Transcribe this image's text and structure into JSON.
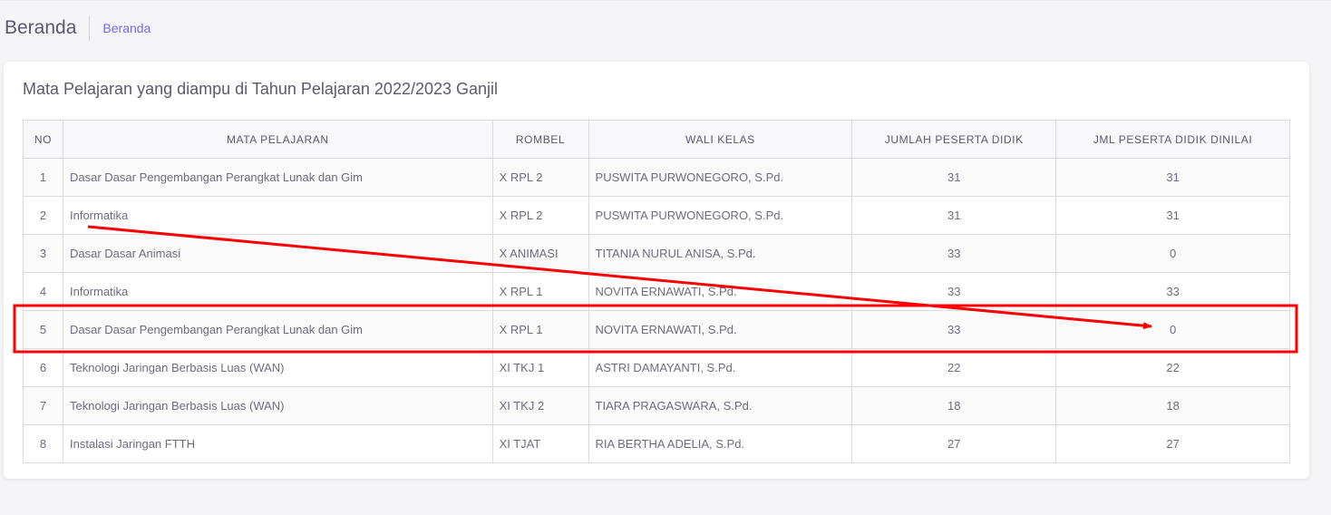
{
  "header": {
    "title": "Beranda",
    "breadcrumb": "Beranda"
  },
  "card": {
    "title": "Mata Pelajaran yang diampu di Tahun Pelajaran 2022/2023 Ganjil"
  },
  "table": {
    "columns": [
      "NO",
      "MATA PELAJARAN",
      "ROMBEL",
      "WALI KELAS",
      "JUMLAH PESERTA DIDIK",
      "JML PESERTA DIDIK DINILAI"
    ],
    "rows": [
      {
        "no": "1",
        "mapel": "Dasar Dasar Pengembangan Perangkat Lunak dan Gim",
        "rombel": "X RPL 2",
        "wali": "PUSWITA PURWONEGORO, S.Pd.",
        "jumlah": "31",
        "dinilai": "31"
      },
      {
        "no": "2",
        "mapel": "Informatika",
        "rombel": "X RPL 2",
        "wali": "PUSWITA PURWONEGORO, S.Pd.",
        "jumlah": "31",
        "dinilai": "31"
      },
      {
        "no": "3",
        "mapel": "Dasar Dasar Animasi",
        "rombel": "X ANIMASI",
        "wali": "TITANIA NURUL ANISA, S.Pd.",
        "jumlah": "33",
        "dinilai": "0"
      },
      {
        "no": "4",
        "mapel": "Informatika",
        "rombel": "X RPL 1",
        "wali": "NOVITA ERNAWATI, S.Pd.",
        "jumlah": "33",
        "dinilai": "33"
      },
      {
        "no": "5",
        "mapel": "Dasar Dasar Pengembangan Perangkat Lunak dan Gim",
        "rombel": "X RPL 1",
        "wali": "NOVITA ERNAWATI, S.Pd.",
        "jumlah": "33",
        "dinilai": "0"
      },
      {
        "no": "6",
        "mapel": "Teknologi Jaringan Berbasis Luas (WAN)",
        "rombel": "XI TKJ 1",
        "wali": "ASTRI DAMAYANTI, S.Pd.",
        "jumlah": "22",
        "dinilai": "22"
      },
      {
        "no": "7",
        "mapel": "Teknologi Jaringan Berbasis Luas (WAN)",
        "rombel": "XI TKJ 2",
        "wali": "TIARA PRAGASWARA, S.Pd.",
        "jumlah": "18",
        "dinilai": "18"
      },
      {
        "no": "8",
        "mapel": "Instalasi Jaringan FTTH",
        "rombel": "XI TJAT",
        "wali": "RIA BERTHA ADELIA, S.Pd.",
        "jumlah": "27",
        "dinilai": "27"
      }
    ]
  },
  "annotation": {
    "color": "#ff0000",
    "highlighted_row": "5"
  }
}
